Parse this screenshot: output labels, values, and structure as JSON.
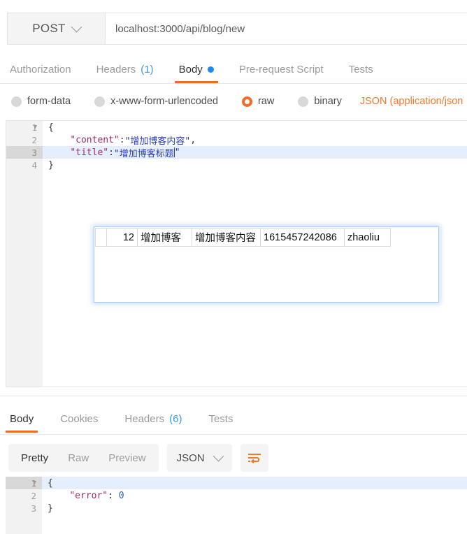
{
  "request": {
    "method": "POST",
    "method_icon": "chevron-down-icon",
    "url": "localhost:3000/api/blog/new",
    "tabs": [
      {
        "label": "Authorization",
        "count": null,
        "dot": false,
        "active": false
      },
      {
        "label": "Headers",
        "count": "(1)",
        "dot": false,
        "active": false
      },
      {
        "label": "Body",
        "count": null,
        "dot": true,
        "active": true
      },
      {
        "label": "Pre-request Script",
        "count": null,
        "dot": false,
        "active": false
      },
      {
        "label": "Tests",
        "count": null,
        "dot": false,
        "active": false
      }
    ],
    "body_types": [
      {
        "label": "form-data",
        "selected": false
      },
      {
        "label": "x-www-form-urlencoded",
        "selected": false
      },
      {
        "label": "raw",
        "selected": true
      },
      {
        "label": "binary",
        "selected": false
      }
    ],
    "content_type_label": "JSON (application/json",
    "editor": {
      "lines": [
        {
          "no": "1",
          "fold": true,
          "highlight": false,
          "tokens": [
            {
              "t": "{",
              "c": "punc"
            }
          ]
        },
        {
          "no": "2",
          "fold": false,
          "highlight": false,
          "tokens": [
            {
              "t": "    ",
              "c": "punc"
            },
            {
              "t": "\"content\"",
              "c": "key"
            },
            {
              "t": ":",
              "c": "punc"
            },
            {
              "t": "\"增加博客内容\"",
              "c": "str"
            },
            {
              "t": ",",
              "c": "punc"
            }
          ]
        },
        {
          "no": "3",
          "fold": false,
          "highlight": true,
          "tokens": [
            {
              "t": "    ",
              "c": "punc"
            },
            {
              "t": "\"title\"",
              "c": "key"
            },
            {
              "t": ":",
              "c": "punc"
            },
            {
              "t": "\"增加博客标题",
              "c": "str"
            },
            {
              "t": "CARET",
              "c": "caret"
            },
            {
              "t": "\"",
              "c": "str"
            }
          ]
        },
        {
          "no": "4",
          "fold": false,
          "highlight": false,
          "tokens": [
            {
              "t": "}",
              "c": "punc"
            }
          ]
        }
      ]
    }
  },
  "overlay": {
    "row": {
      "blank": "",
      "id": "12",
      "title": "增加博客",
      "content": "增加博客内容",
      "timestamp": "1615457242086",
      "author": "zhaoliu"
    }
  },
  "response": {
    "tabs": [
      {
        "label": "Body",
        "count": null,
        "active": true
      },
      {
        "label": "Cookies",
        "count": null,
        "active": false
      },
      {
        "label": "Headers",
        "count": "(6)",
        "active": false
      },
      {
        "label": "Tests",
        "count": null,
        "active": false
      }
    ],
    "view_modes": [
      {
        "label": "Pretty",
        "active": true
      },
      {
        "label": "Raw",
        "active": false
      },
      {
        "label": "Preview",
        "active": false
      }
    ],
    "format": "JSON",
    "format_icon": "chevron-down-icon",
    "wrap_icon": "wrap-lines-icon",
    "editor": {
      "lines": [
        {
          "no": "1",
          "fold": true,
          "highlight": true,
          "tokens": [
            {
              "t": "{",
              "c": "punc"
            }
          ]
        },
        {
          "no": "2",
          "fold": false,
          "highlight": false,
          "tokens": [
            {
              "t": "    ",
              "c": "punc"
            },
            {
              "t": "\"error\"",
              "c": "key"
            },
            {
              "t": ": ",
              "c": "punc"
            },
            {
              "t": "0",
              "c": "num"
            }
          ]
        },
        {
          "no": "3",
          "fold": false,
          "highlight": false,
          "tokens": [
            {
              "t": "}",
              "c": "punc"
            }
          ]
        }
      ]
    }
  },
  "colors": {
    "accent_orange": "#ef6c23",
    "link_blue": "#3a9ae8",
    "dot_blue": "#1d8bf0",
    "content_type": "#f0792f"
  }
}
